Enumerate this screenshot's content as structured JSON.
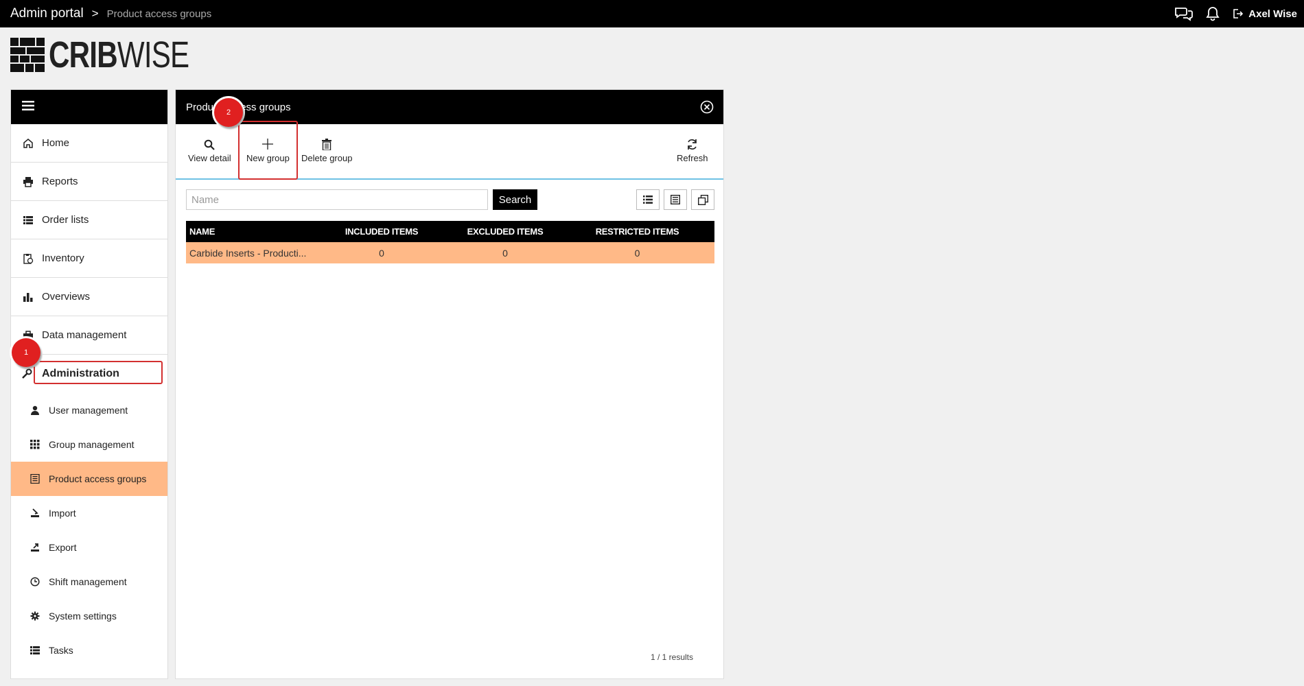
{
  "topbar": {
    "app_name": "Admin portal",
    "separator": ">",
    "current_page": "Product access groups",
    "user_name": "Axel Wise"
  },
  "logo": {
    "bold": "CRIB",
    "light": "WISE"
  },
  "sidebar": {
    "items": [
      {
        "label": "Home"
      },
      {
        "label": "Reports"
      },
      {
        "label": "Order lists"
      },
      {
        "label": "Inventory"
      },
      {
        "label": "Overviews"
      },
      {
        "label": "Data management"
      }
    ],
    "admin_label": "Administration",
    "sub_items": [
      {
        "label": "User management"
      },
      {
        "label": "Group management"
      },
      {
        "label": "Product access groups",
        "active": true
      },
      {
        "label": "Import"
      },
      {
        "label": "Export"
      },
      {
        "label": "Shift management"
      },
      {
        "label": "System settings"
      },
      {
        "label": "Tasks"
      }
    ]
  },
  "panel": {
    "title": "Product access groups",
    "toolbar": {
      "view_detail": "View detail",
      "new_group": "New group",
      "delete_group": "Delete group",
      "refresh": "Refresh"
    },
    "search": {
      "placeholder": "Name",
      "button": "Search"
    },
    "table": {
      "headers": [
        "NAME",
        "INCLUDED ITEMS",
        "EXCLUDED ITEMS",
        "RESTRICTED ITEMS"
      ],
      "rows": [
        {
          "name": "Carbide Inserts - Producti...",
          "included": "0",
          "excluded": "0",
          "restricted": "0"
        }
      ]
    },
    "results": "1 / 1 results"
  },
  "annotations": {
    "step1": "1",
    "step2": "2",
    "color": "#e02020"
  },
  "colors": {
    "accent": "#ffb987",
    "divider": "#6ec1e4",
    "header": "#000000"
  }
}
